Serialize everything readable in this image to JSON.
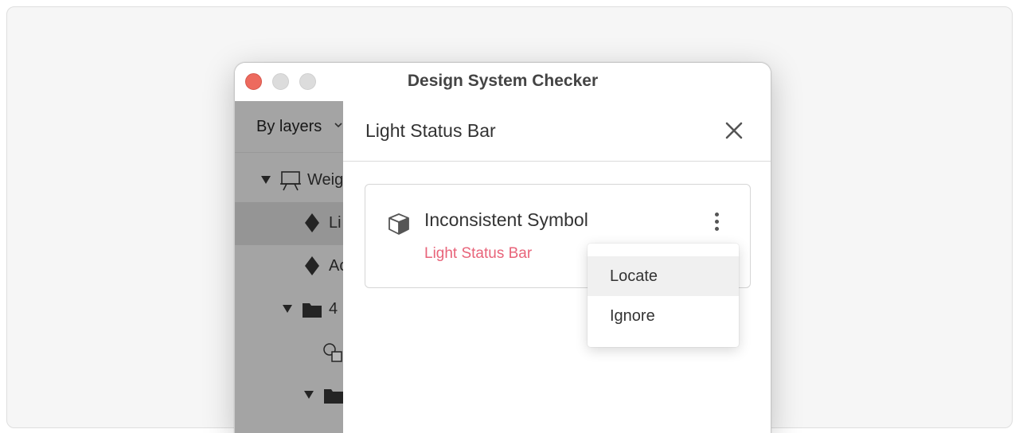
{
  "window": {
    "title": "Design System Checker"
  },
  "sidebar": {
    "filter_label": "By layers",
    "rows": [
      {
        "label": "Weig",
        "icon": "artboard-icon",
        "expand": "disclosure-triangle"
      },
      {
        "label": "Li",
        "icon": "symbol-diamond-icon",
        "selected": true
      },
      {
        "label": "Ac",
        "icon": "symbol-diamond-icon"
      },
      {
        "label": "4",
        "icon": "folder-icon",
        "expand": "disclosure-triangle"
      },
      {
        "label": "",
        "icon": "shapes-icon"
      },
      {
        "label": "",
        "icon": "folder-icon",
        "expand": "disclosure-triangle"
      }
    ]
  },
  "panel": {
    "title": "Light Status Bar",
    "issue": {
      "icon": "box-icon",
      "title": "Inconsistent Symbol",
      "link": "Light Status Bar"
    }
  },
  "menu": {
    "items": [
      {
        "label": "Locate",
        "hovered": true
      },
      {
        "label": "Ignore"
      }
    ]
  },
  "colors": {
    "accent_link": "#e8647a",
    "traffic_close": "#ed6a5e",
    "traffic_inactive": "#dcdcdc"
  }
}
